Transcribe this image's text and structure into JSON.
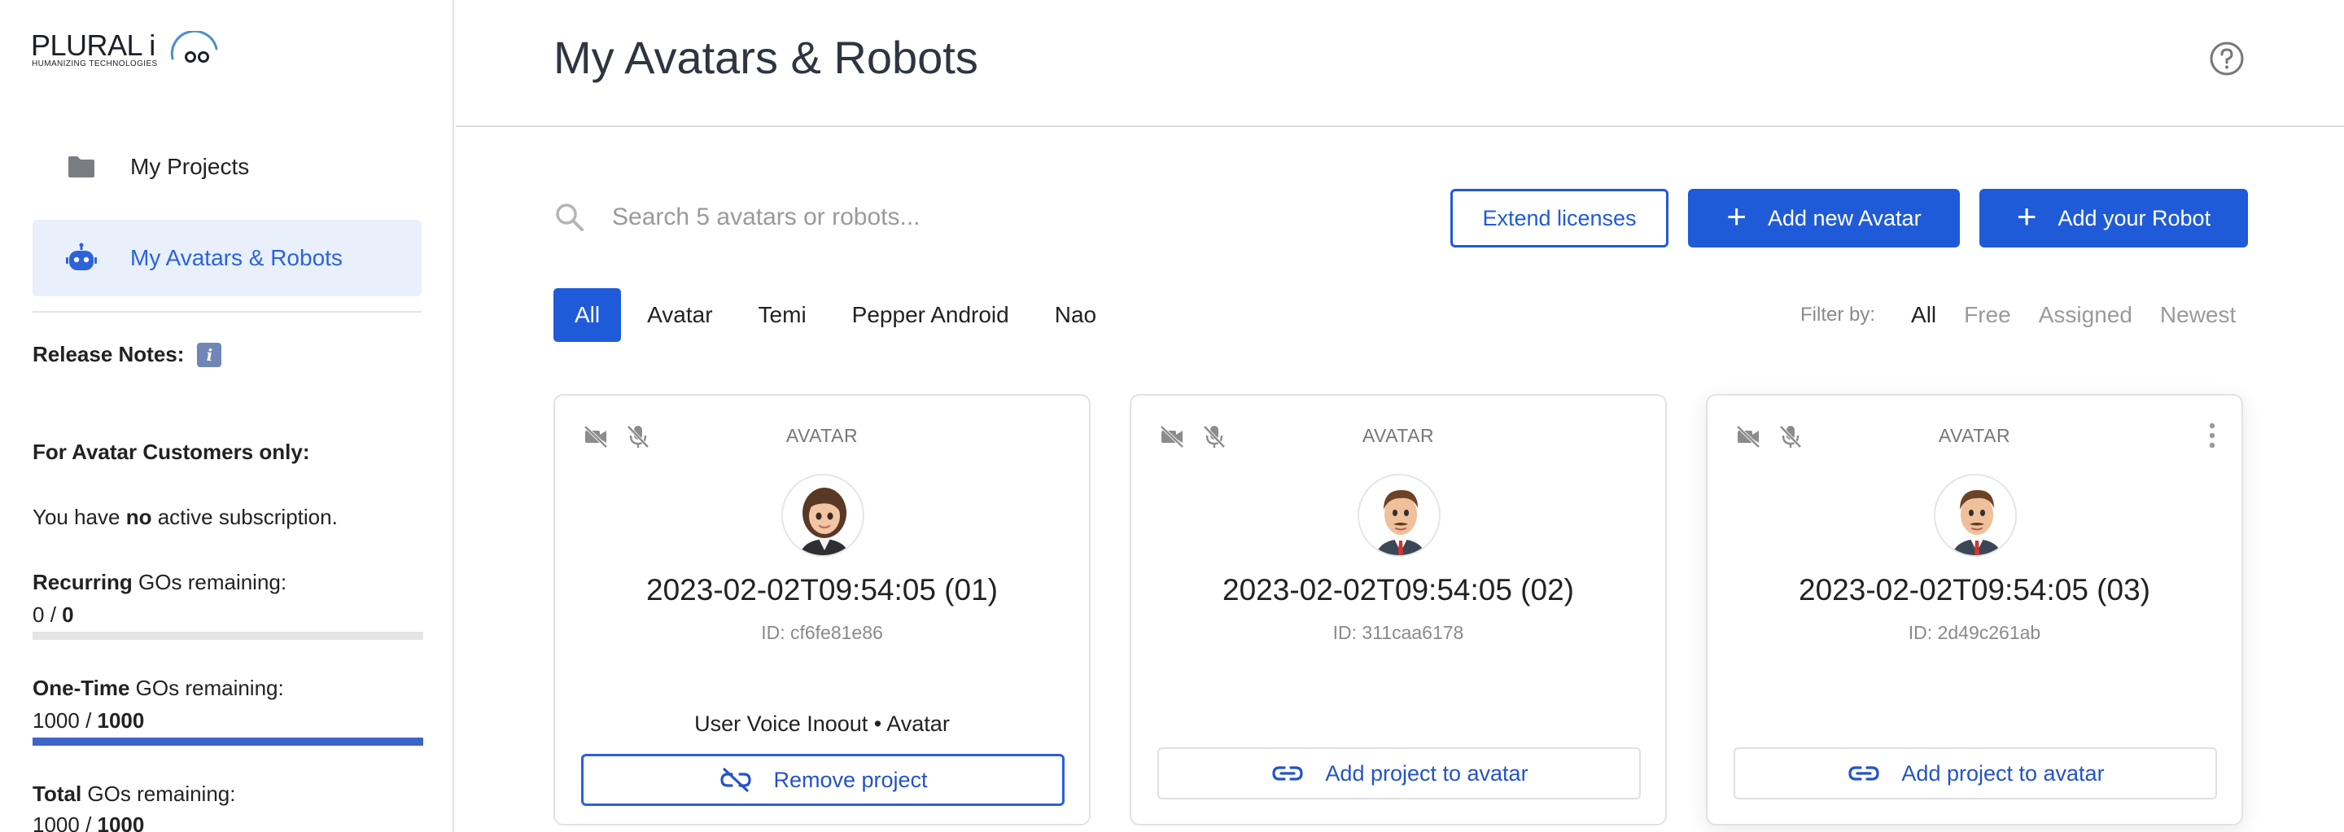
{
  "brand": {
    "name": "PLURAL i",
    "tagline": "HUMANIZING TECHNOLOGIES"
  },
  "sidebar": {
    "nav": [
      {
        "label": "My Projects",
        "icon": "folder-icon",
        "active": false
      },
      {
        "label": "My Avatars & Robots",
        "icon": "robot-icon",
        "active": true
      }
    ],
    "release_notes_label": "Release Notes:",
    "release_notes_icon": "i",
    "customers_heading": "For Avatar Customers only:",
    "subscription": {
      "prefix": "You have ",
      "emphasis": "no",
      "suffix": " active subscription."
    },
    "gos": [
      {
        "label_bold": "Recurring",
        "label_rest": " GOs remaining:",
        "used": "0",
        "total": "0",
        "fill_fraction": 0.0
      },
      {
        "label_bold": "One-Time",
        "label_rest": " GOs remaining:",
        "used": "1000",
        "total": "1000",
        "fill_fraction": 1.0
      },
      {
        "label_bold": "Total",
        "label_rest": " GOs remaining:",
        "used": "1000",
        "total": "1000",
        "fill_fraction": 1.0
      }
    ],
    "separator": " / "
  },
  "header": {
    "title": "My Avatars & Robots",
    "help_icon": "help-circle-icon"
  },
  "toolbar": {
    "search_placeholder": "Search 5 avatars or robots...",
    "extend_label": "Extend licenses",
    "add_avatar_label": "Add new Avatar",
    "add_robot_label": "Add your Robot",
    "plus": "+"
  },
  "tabs": [
    "All",
    "Avatar",
    "Temi",
    "Pepper Android",
    "Nao"
  ],
  "active_tab": "All",
  "filter": {
    "label": "Filter by:",
    "options": [
      "All",
      "Free",
      "Assigned",
      "Newest"
    ],
    "active": "All"
  },
  "cards": [
    {
      "type": "AVATAR",
      "name": "2023-02-02T09:54:05 (01)",
      "id": "ID: cf6fe81e86",
      "project": "User Voice Inoout • Avatar",
      "action": "Remove project",
      "avatar": "female"
    },
    {
      "type": "AVATAR",
      "name": "2023-02-02T09:54:05 (02)",
      "id": "ID: 311caa6178",
      "project": "",
      "action": "Add project to avatar",
      "avatar": "male"
    },
    {
      "type": "AVATAR",
      "name": "2023-02-02T09:54:05 (03)",
      "id": "ID: 2d49c261ab",
      "project": "",
      "action": "Add project to avatar",
      "avatar": "male"
    }
  ],
  "colors": {
    "primary": "#1f5bd8",
    "nav_active_bg": "#e9f0fc",
    "progress_fill": "#3b64c6"
  }
}
